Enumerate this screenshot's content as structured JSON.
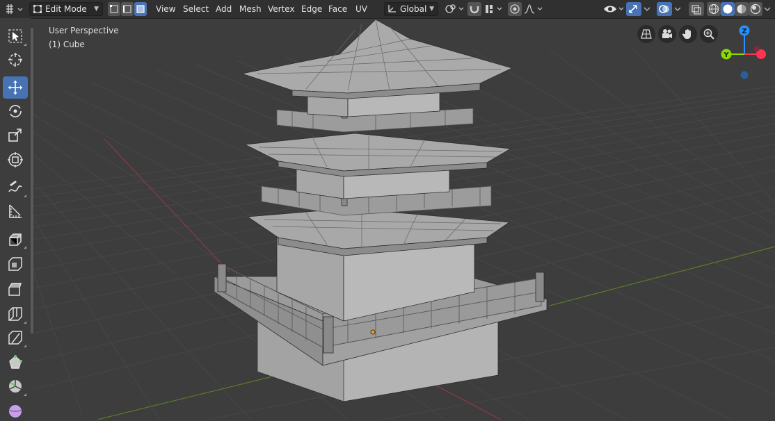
{
  "header": {
    "editor_icon": "cursor-grid-icon",
    "mode": "Edit Mode",
    "menus": [
      "View",
      "Select",
      "Add",
      "Mesh",
      "Vertex",
      "Edge",
      "Face",
      "UV"
    ],
    "transform_orientation": "Global"
  },
  "viewport": {
    "view_name": "User Perspective",
    "object_label": "(1) Cube"
  },
  "toolbar": {
    "tools": [
      "select-box-icon",
      "cursor-icon",
      "move-icon",
      "rotate-icon",
      "scale-icon",
      "transform-icon",
      "annotate-icon",
      "measure-icon",
      "extrude-icon",
      "inset-icon",
      "bevel-icon",
      "loop-cut-icon",
      "knife-icon",
      "poly-build-icon",
      "spin-icon",
      "smooth-icon"
    ],
    "active_tool": "move-icon"
  },
  "navigation": [
    "perspective-toggle-icon",
    "camera-icon",
    "hand-pan-icon",
    "zoom-icon"
  ],
  "colors": {
    "accent": "#4772b3",
    "header_bg": "#303030",
    "viewport_bg": "#3d3d3d",
    "axis_x": "#ff3352",
    "axis_y": "#8bdc00",
    "axis_z": "#2890ff"
  }
}
